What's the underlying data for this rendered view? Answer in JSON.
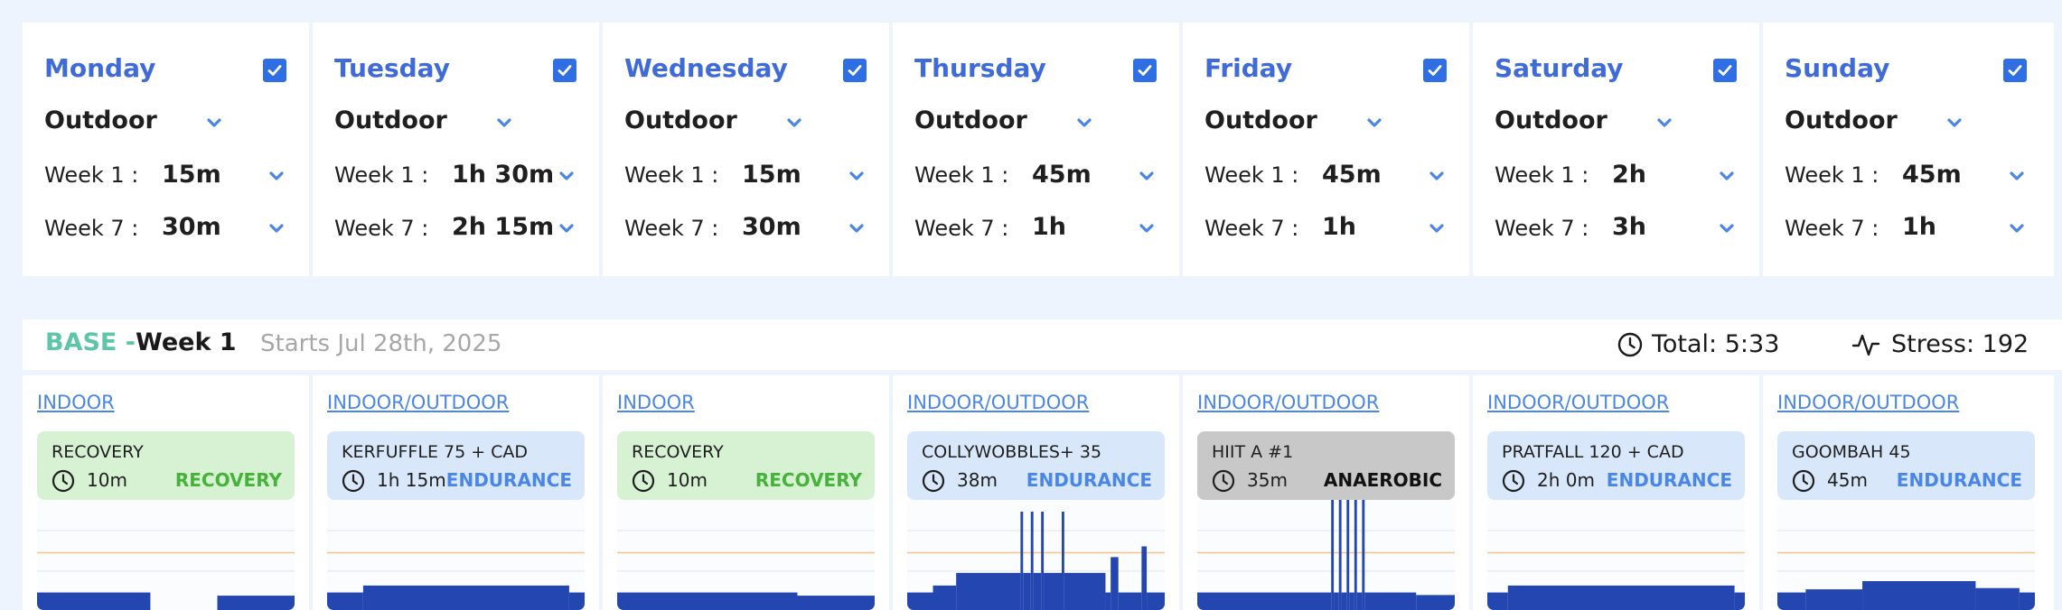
{
  "colors": {
    "accent": "#3f6bd8",
    "checkbox": "#2f6fe3",
    "chevron": "#4a86e8",
    "phase": "#5ec5a9",
    "chart_fill": "#2446b0",
    "threshold_line": "#f6c48a",
    "recovery_bg": "#d6f2d3",
    "recovery_text": "#46b23a",
    "endurance_bg": "#d8e8fa",
    "endurance_text": "#4a86e8",
    "anaerobic_bg": "#c8c8c8",
    "anaerobic_text": "#111111"
  },
  "week_settings": {
    "week1_label": "Week 1 :",
    "week7_label": "Week 7 :",
    "days": [
      {
        "name": "Monday",
        "checked": true,
        "location": "Outdoor",
        "week1": "15m",
        "week7": "30m"
      },
      {
        "name": "Tuesday",
        "checked": true,
        "location": "Outdoor",
        "week1": "1h 30m",
        "week7": "2h 15m"
      },
      {
        "name": "Wednesday",
        "checked": true,
        "location": "Outdoor",
        "week1": "15m",
        "week7": "30m"
      },
      {
        "name": "Thursday",
        "checked": true,
        "location": "Outdoor",
        "week1": "45m",
        "week7": "1h"
      },
      {
        "name": "Friday",
        "checked": true,
        "location": "Outdoor",
        "week1": "45m",
        "week7": "1h"
      },
      {
        "name": "Saturday",
        "checked": true,
        "location": "Outdoor",
        "week1": "2h",
        "week7": "3h"
      },
      {
        "name": "Sunday",
        "checked": true,
        "location": "Outdoor",
        "week1": "45m",
        "week7": "1h"
      }
    ]
  },
  "week_header": {
    "phase": "BASE -",
    "week": "Week 1",
    "starts": "Starts Jul 28th, 2025",
    "total": "Total: 5:33",
    "stress": "Stress: 192",
    "total_icon": "clock-icon",
    "stress_icon": "pulse-icon"
  },
  "workouts": [
    {
      "link": "INDOOR",
      "name": "RECOVERY",
      "duration": "10m",
      "category": "RECOVERY",
      "kind": "recovery",
      "profile": [
        [
          0,
          0.44,
          0.22
        ],
        [
          0.7,
          1,
          0.17
        ]
      ]
    },
    {
      "link": "INDOOR/OUTDOOR",
      "name": "KERFUFFLE 75 + CAD",
      "duration": "1h 15m",
      "category": "ENDURANCE",
      "kind": "endurance",
      "profile": [
        [
          0,
          0.14,
          0.22
        ],
        [
          0.14,
          0.94,
          0.33
        ],
        [
          0.94,
          1,
          0.22
        ]
      ]
    },
    {
      "link": "INDOOR",
      "name": "RECOVERY",
      "duration": "10m",
      "category": "RECOVERY",
      "kind": "recovery",
      "profile": [
        [
          0,
          0.7,
          0.22
        ],
        [
          0.7,
          1,
          0.17
        ]
      ]
    },
    {
      "link": "INDOOR/OUTDOOR",
      "name": "COLLYWOBBLES+ 35",
      "duration": "38m",
      "category": "ENDURANCE",
      "kind": "endurance",
      "profile": [
        [
          0,
          0.1,
          0.22
        ],
        [
          0.1,
          0.19,
          0.33
        ],
        [
          0.19,
          0.44,
          0.53
        ],
        [
          0.44,
          0.45,
          1.5
        ],
        [
          0.45,
          0.48,
          0.53
        ],
        [
          0.48,
          0.49,
          1.5
        ],
        [
          0.49,
          0.52,
          0.53
        ],
        [
          0.52,
          0.53,
          1.5
        ],
        [
          0.53,
          0.6,
          0.53
        ],
        [
          0.6,
          0.61,
          1.5
        ],
        [
          0.61,
          0.77,
          0.53
        ],
        [
          0.77,
          0.79,
          0.22
        ],
        [
          0.79,
          0.82,
          0.78
        ],
        [
          0.82,
          0.91,
          0.22
        ],
        [
          0.91,
          0.93,
          0.95
        ],
        [
          0.93,
          1,
          0.22
        ]
      ]
    },
    {
      "link": "INDOOR/OUTDOOR",
      "name": "HIIT A #1",
      "duration": "35m",
      "category": "ANAEROBIC",
      "kind": "anaerobic",
      "profile": [
        [
          0,
          0.52,
          0.22
        ],
        [
          0.52,
          0.53,
          1.8
        ],
        [
          0.53,
          0.55,
          0.22
        ],
        [
          0.55,
          0.56,
          1.8
        ],
        [
          0.56,
          0.58,
          0.22
        ],
        [
          0.58,
          0.59,
          1.8
        ],
        [
          0.59,
          0.61,
          0.22
        ],
        [
          0.61,
          0.62,
          1.8
        ],
        [
          0.62,
          0.64,
          0.22
        ],
        [
          0.64,
          0.65,
          1.8
        ],
        [
          0.65,
          0.85,
          0.22
        ],
        [
          0.85,
          1,
          0.18
        ]
      ]
    },
    {
      "link": "INDOOR/OUTDOOR",
      "name": "PRATFALL 120 + CAD",
      "duration": "2h 0m",
      "category": "ENDURANCE",
      "kind": "endurance",
      "profile": [
        [
          0,
          0.08,
          0.22
        ],
        [
          0.08,
          0.96,
          0.33
        ],
        [
          0.96,
          1,
          0.22
        ]
      ]
    },
    {
      "link": "INDOOR/OUTDOOR",
      "name": "GOOMBAH 45",
      "duration": "45m",
      "category": "ENDURANCE",
      "kind": "endurance",
      "profile": [
        [
          0,
          0.11,
          0.22
        ],
        [
          0.11,
          0.33,
          0.27
        ],
        [
          0.33,
          0.77,
          0.4
        ],
        [
          0.77,
          0.94,
          0.29
        ],
        [
          0.94,
          1,
          0.22
        ]
      ]
    }
  ]
}
